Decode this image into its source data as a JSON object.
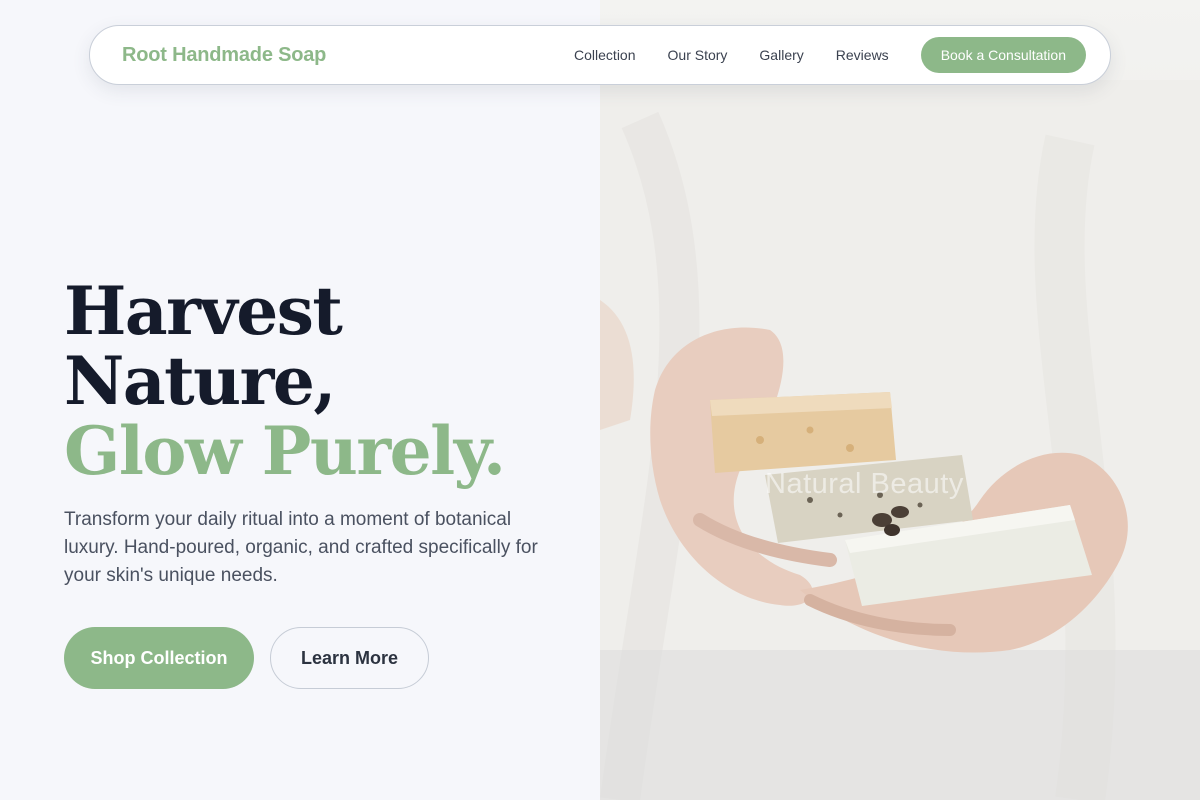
{
  "brand": {
    "name": "Root Handmade Soap"
  },
  "nav": {
    "links": [
      "Collection",
      "Our Story",
      "Gallery",
      "Reviews"
    ],
    "cta_label": "Book a Consultation"
  },
  "hero": {
    "headline_line1": "Harvest",
    "headline_line2": "Nature,",
    "headline_accent": "Glow Purely.",
    "subtext": "Transform your daily ritual into a moment of botanical luxury. Hand-poured, organic, and crafted specifically for your skin's unique needs.",
    "primary_button": "Shop Collection",
    "secondary_button": "Learn More",
    "image_watermark": "Natural Beauty"
  },
  "colors": {
    "accent": "#8db889",
    "heading": "#151b2b",
    "body_text": "#4a5160",
    "background": "#f6f7fb"
  }
}
